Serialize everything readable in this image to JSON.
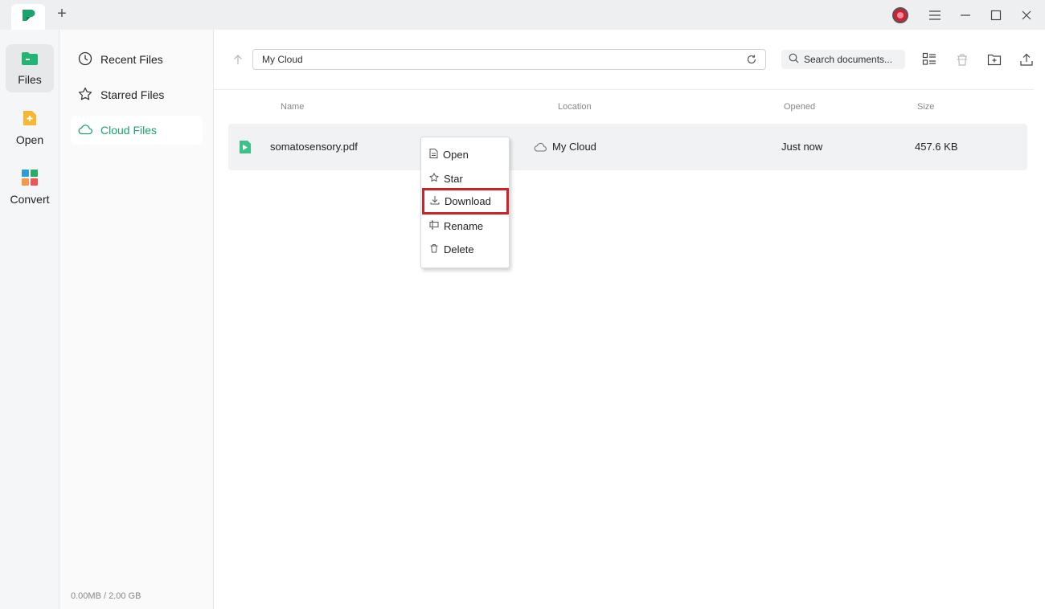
{
  "colors": {
    "accent": "#1aa36b",
    "highlight": "#d0202a"
  },
  "titlebar": {
    "new_tab_label": "+",
    "icons": [
      "app-logo-icon",
      "avatar-icon",
      "menu-icon",
      "minimize-icon",
      "maximize-icon",
      "close-icon"
    ]
  },
  "rail": {
    "items": [
      {
        "label": "Files",
        "icon": "files-icon",
        "active": true
      },
      {
        "label": "Open",
        "icon": "open-icon",
        "active": false
      },
      {
        "label": "Convert",
        "icon": "convert-icon",
        "active": false
      }
    ]
  },
  "nav": {
    "items": [
      {
        "label": "Recent Files",
        "icon": "clock-icon"
      },
      {
        "label": "Starred Files",
        "icon": "star-icon"
      },
      {
        "label": "Cloud Files",
        "icon": "cloud-icon",
        "active": true
      }
    ],
    "storage": "0.00MB  / 2.00 GB"
  },
  "toolbar": {
    "path": "My Cloud",
    "search_placeholder": "Search documents..."
  },
  "table": {
    "headers": {
      "name": "Name",
      "location": "Location",
      "opened": "Opened",
      "size": "Size"
    },
    "rows": [
      {
        "name": "somatosensory.pdf",
        "location": "My Cloud",
        "opened": "Just now",
        "size": "457.6 KB"
      }
    ]
  },
  "context_menu": {
    "items": [
      {
        "label": "Open",
        "icon": "document-icon"
      },
      {
        "label": "Star",
        "icon": "star-icon"
      },
      {
        "label": "Download",
        "icon": "download-icon",
        "highlighted": true
      },
      {
        "label": "Rename",
        "icon": "rename-icon"
      },
      {
        "label": "Delete",
        "icon": "trash-icon"
      }
    ]
  }
}
